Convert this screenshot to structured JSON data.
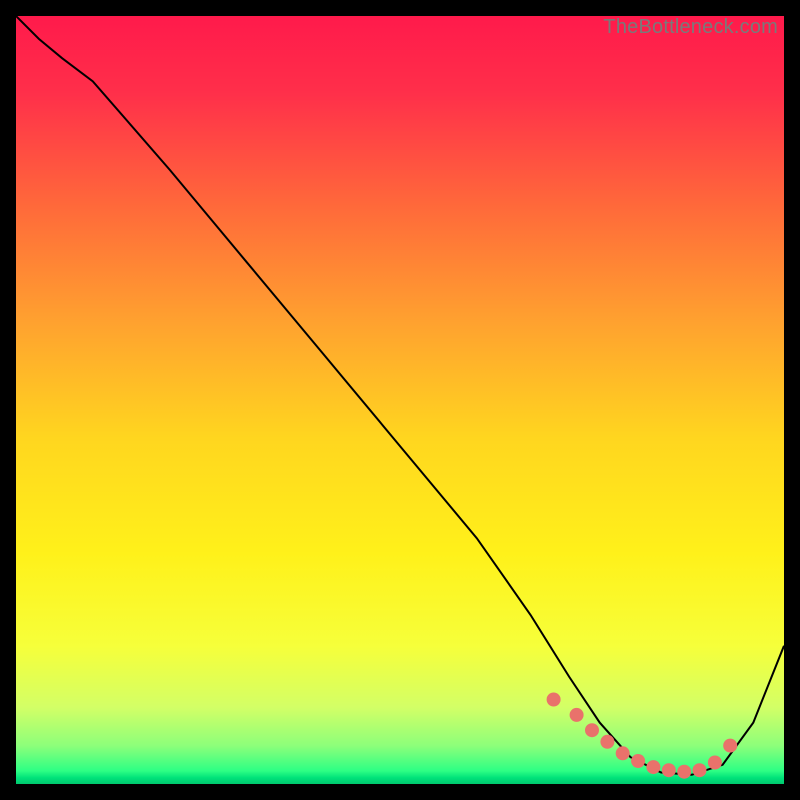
{
  "watermark": "TheBottleneck.com",
  "chart_data": {
    "type": "line",
    "title": "",
    "xlabel": "",
    "ylabel": "",
    "xlim": [
      0,
      100
    ],
    "ylim": [
      0,
      100
    ],
    "series": [
      {
        "name": "curve",
        "x": [
          0,
          3,
          6,
          10,
          20,
          30,
          40,
          50,
          60,
          67,
          72,
          76,
          80,
          84,
          88,
          92,
          96,
          100
        ],
        "y": [
          100,
          97,
          94.5,
          91.5,
          80,
          68,
          56,
          44,
          32,
          22,
          14,
          8,
          3.5,
          1.5,
          1.2,
          2.5,
          8,
          18
        ]
      }
    ],
    "markers": {
      "name": "dots",
      "x": [
        70,
        73,
        75,
        77,
        79,
        81,
        83,
        85,
        87,
        89,
        91,
        93
      ],
      "y": [
        11,
        9,
        7,
        5.5,
        4,
        3,
        2.2,
        1.8,
        1.6,
        1.8,
        2.8,
        5
      ]
    },
    "gradient_stops": [
      {
        "pos": 0.0,
        "color": "#ff1a4b"
      },
      {
        "pos": 0.1,
        "color": "#ff2f4a"
      },
      {
        "pos": 0.25,
        "color": "#ff6a3a"
      },
      {
        "pos": 0.4,
        "color": "#ffa22f"
      },
      {
        "pos": 0.55,
        "color": "#ffd61f"
      },
      {
        "pos": 0.7,
        "color": "#fff11a"
      },
      {
        "pos": 0.82,
        "color": "#f6ff3a"
      },
      {
        "pos": 0.9,
        "color": "#d3ff66"
      },
      {
        "pos": 0.95,
        "color": "#8dff7a"
      },
      {
        "pos": 0.983,
        "color": "#2dff84"
      },
      {
        "pos": 0.992,
        "color": "#00e27a"
      },
      {
        "pos": 1.0,
        "color": "#00c96e"
      }
    ],
    "curve_color": "#000000",
    "marker_color": "#e9726b",
    "marker_radius": 7
  }
}
